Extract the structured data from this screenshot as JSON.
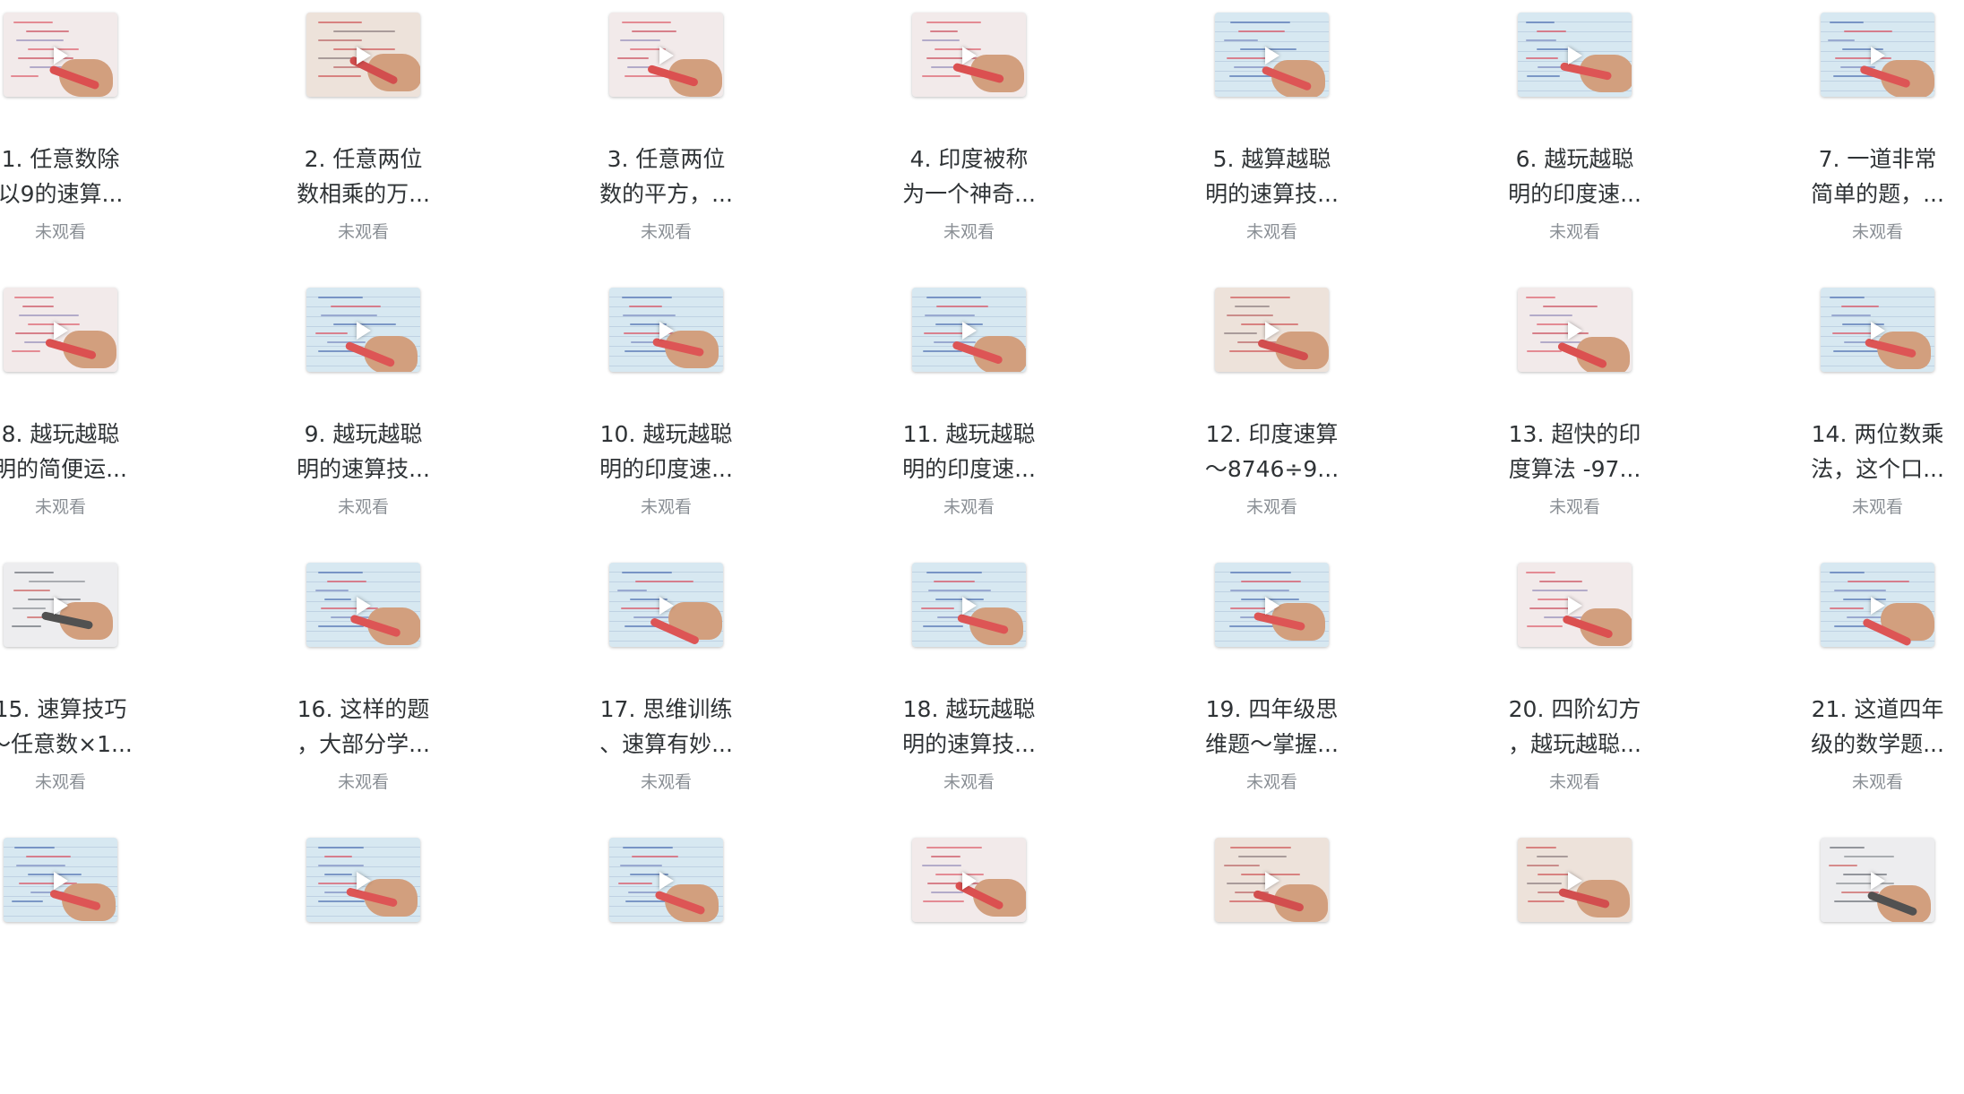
{
  "colors": {
    "title_text": "#2f3336",
    "status_text": "#8a8f95",
    "page_background": "#ffffff",
    "play_icon": "#ffffff"
  },
  "video_list": {
    "items": [
      {
        "title_line1": "1. 任意数除",
        "title_line2": "以9的速算...",
        "status": "未观看",
        "thumb_style": "pink"
      },
      {
        "title_line1": "2. 任意两位",
        "title_line2": "数相乘的万...",
        "status": "未观看",
        "thumb_style": "warm"
      },
      {
        "title_line1": "3. 任意两位",
        "title_line2": "数的平方，...",
        "status": "未观看",
        "thumb_style": "pink"
      },
      {
        "title_line1": "4. 印度被称",
        "title_line2": "为一个神奇...",
        "status": "未观看",
        "thumb_style": "pink"
      },
      {
        "title_line1": "5. 越算越聪",
        "title_line2": "明的速算技...",
        "status": "未观看",
        "thumb_style": "blue"
      },
      {
        "title_line1": "6. 越玩越聪",
        "title_line2": "明的印度速...",
        "status": "未观看",
        "thumb_style": "blue"
      },
      {
        "title_line1": "7. 一道非常",
        "title_line2": "简单的题，...",
        "status": "未观看",
        "thumb_style": "blue"
      },
      {
        "title_line1": "8. 越玩越聪",
        "title_line2": "明的简便运...",
        "status": "未观看",
        "thumb_style": "pink"
      },
      {
        "title_line1": "9. 越玩越聪",
        "title_line2": "明的速算技...",
        "status": "未观看",
        "thumb_style": "blue"
      },
      {
        "title_line1": "10. 越玩越聪",
        "title_line2": "明的印度速...",
        "status": "未观看",
        "thumb_style": "blue"
      },
      {
        "title_line1": "11. 越玩越聪",
        "title_line2": "明的印度速...",
        "status": "未观看",
        "thumb_style": "blue"
      },
      {
        "title_line1": "12. 印度速算",
        "title_line2": "～8746÷9...",
        "status": "未观看",
        "thumb_style": "warm"
      },
      {
        "title_line1": "13. 超快的印",
        "title_line2": "度算法 -97...",
        "status": "未观看",
        "thumb_style": "pink"
      },
      {
        "title_line1": "14. 两位数乘",
        "title_line2": "法，这个口...",
        "status": "未观看",
        "thumb_style": "blue"
      },
      {
        "title_line1": "15. 速算技巧",
        "title_line2": "～任意数×1...",
        "status": "未观看",
        "thumb_style": "gray"
      },
      {
        "title_line1": "16. 这样的题",
        "title_line2": "，大部分学...",
        "status": "未观看",
        "thumb_style": "blue"
      },
      {
        "title_line1": "17. 思维训练",
        "title_line2": "、速算有妙...",
        "status": "未观看",
        "thumb_style": "blue"
      },
      {
        "title_line1": "18. 越玩越聪",
        "title_line2": "明的速算技...",
        "status": "未观看",
        "thumb_style": "blue"
      },
      {
        "title_line1": "19. 四年级思",
        "title_line2": "维题～掌握...",
        "status": "未观看",
        "thumb_style": "blue"
      },
      {
        "title_line1": "20. 四阶幻方",
        "title_line2": "，越玩越聪...",
        "status": "未观看",
        "thumb_style": "pink"
      },
      {
        "title_line1": "21. 这道四年",
        "title_line2": "级的数学题...",
        "status": "未观看",
        "thumb_style": "blue"
      },
      {
        "title_line1": "",
        "title_line2": "",
        "status": "",
        "thumb_style": "blue"
      },
      {
        "title_line1": "",
        "title_line2": "",
        "status": "",
        "thumb_style": "blue"
      },
      {
        "title_line1": "",
        "title_line2": "",
        "status": "",
        "thumb_style": "blue"
      },
      {
        "title_line1": "",
        "title_line2": "",
        "status": "",
        "thumb_style": "pink"
      },
      {
        "title_line1": "",
        "title_line2": "",
        "status": "",
        "thumb_style": "warm"
      },
      {
        "title_line1": "",
        "title_line2": "",
        "status": "",
        "thumb_style": "warm"
      },
      {
        "title_line1": "",
        "title_line2": "",
        "status": "",
        "thumb_style": "gray"
      }
    ]
  }
}
